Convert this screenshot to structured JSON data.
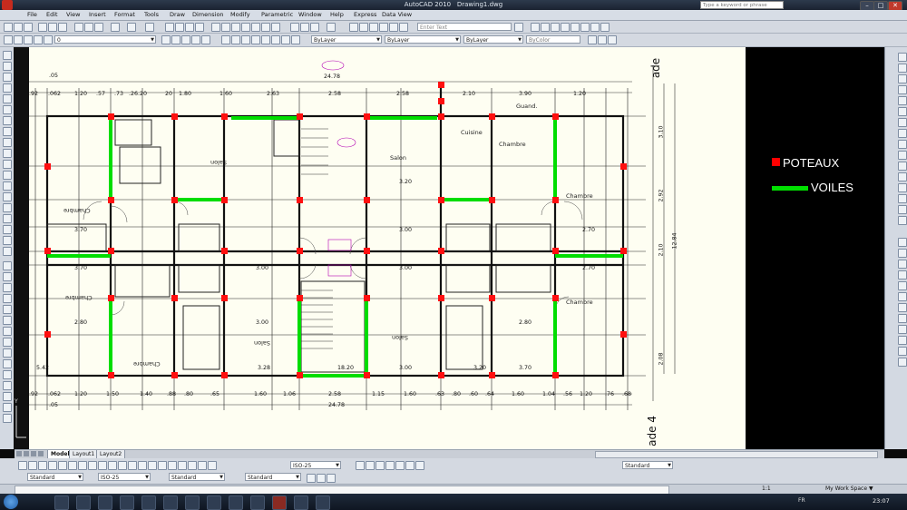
{
  "titlebar": {
    "app": "AutoCAD 2010",
    "file": "Drawing1.dwg",
    "search_placeholder": "Type a keyword or phrase"
  },
  "menu": [
    "File",
    "Edit",
    "View",
    "Insert",
    "Format",
    "Tools",
    "Draw",
    "Dimension",
    "Modify",
    "Parametric",
    "Window",
    "Help",
    "Express",
    "Data View"
  ],
  "toolbar": {
    "layer_value": "0",
    "color_value": "ByLayer",
    "linetype_value": "ByLayer",
    "lineweight_value": "ByLayer",
    "plotstyle_value": "ByColor",
    "enter_text_placeholder": "Enter Text"
  },
  "drawing": {
    "top_dims": [
      ".92",
      ".062",
      "1.20",
      ".57",
      ".73",
      ".26.20",
      "20",
      "1.80",
      "1.60",
      "2.63",
      "2.58",
      "2.58",
      "2.10",
      "3.90",
      "1.20"
    ],
    "bottom_dims": [
      ".92",
      ".062",
      "1.20",
      "1.50",
      "1.40",
      ".88",
      ".80",
      ".65",
      "1.60",
      "1.06",
      "2.58",
      "1.15",
      "1.60",
      ".63",
      ".80",
      ".60",
      ".64",
      "1.60",
      "1.04",
      ".56",
      "1.20",
      ".76",
      ".68"
    ],
    "total_top": "24.78",
    "total_bottom": "24.78",
    "top_left_dim": ".05",
    "bottom_left_dim": ".05",
    "rooms": [
      "Salon",
      "Chambre",
      "Cuisine",
      "Guand.",
      "Salon",
      "Chambre",
      "Chambre",
      "Chambre",
      "Salon",
      "Salon",
      "Chambre",
      "Chambre"
    ],
    "facade_top": "ade",
    "facade_bottom": "ade 4",
    "right_dims": [
      "3.10",
      "2.92",
      "2.10",
      "2.08",
      "12.84"
    ],
    "bottom_row_dims": [
      "5.42",
      "2.80",
      "3.28",
      "3.20",
      "18.20",
      "3.00",
      "3.70",
      "2.80"
    ],
    "mid_row_dims": [
      "3.70",
      "3.70",
      "3.00",
      "3.00",
      "3.00",
      "2.70",
      "2.70",
      "3.20",
      "3.00"
    ]
  },
  "legend": [
    {
      "label": "POTEAUX",
      "color": "#ff0000"
    },
    {
      "label": "VOILES",
      "color": "#00e000"
    }
  ],
  "tabs": [
    "Model",
    "Layout1",
    "Layout2"
  ],
  "bottom_toolbar": {
    "textstyle": "Standard",
    "dimstyle": "ISO-25",
    "tablestyle": "Standard",
    "mleaderstyle": "Standard",
    "dimstyle2": "ISO-25",
    "textstyle2": "Standard"
  },
  "status": {
    "scale": "1:1",
    "workspace": "My Work Space",
    "time": "23:07",
    "lang": "FR"
  }
}
